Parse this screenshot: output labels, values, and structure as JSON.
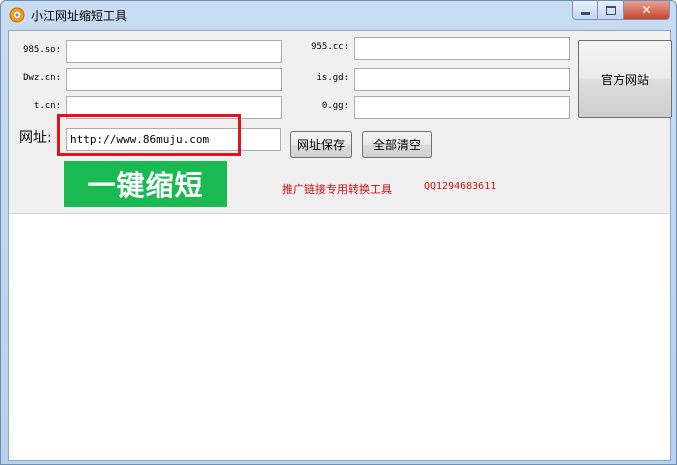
{
  "window": {
    "title": "小江网址缩短工具",
    "icon": "app-logo-icon",
    "caption_minimize": "minimize-icon",
    "caption_maximize": "maximize-icon",
    "caption_close": "✕"
  },
  "fields": {
    "s985": {
      "label": "985.so:",
      "value": ""
    },
    "dwz": {
      "label": "Dwz.cn:",
      "value": ""
    },
    "tcn": {
      "label": "t.cn:",
      "value": ""
    },
    "s955": {
      "label": "955.cc:",
      "value": ""
    },
    "isgd": {
      "label": "is.gd:",
      "value": ""
    },
    "ogg": {
      "label": "0.gg:",
      "value": ""
    }
  },
  "url": {
    "label": "网址:",
    "value": "http://www.86muju.com"
  },
  "buttons": {
    "official_site": "官方网站",
    "save_url": "网址保存",
    "clear_all": "全部清空",
    "shorten": "一键缩短"
  },
  "promo": {
    "text": "推广链接专用转换工具",
    "qq": "QQ1294683611"
  },
  "colors": {
    "accent_green": "#1aba52",
    "highlight_red": "#e0141e",
    "promo_red": "#cc1111"
  }
}
